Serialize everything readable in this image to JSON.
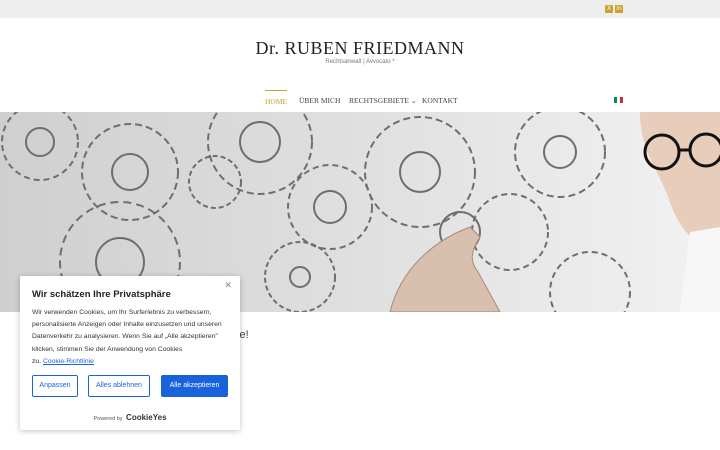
{
  "topbar": {
    "social": [
      "xing-icon",
      "linkedin-icon"
    ],
    "accent": "#c9a227"
  },
  "site": {
    "title": "Dr. RUBEN FRIEDMANN",
    "tagline": "Rechtsanwalt | Avvocato *"
  },
  "nav": {
    "items": [
      {
        "label": "HOME",
        "active": true
      },
      {
        "label": "ÜBER MICH"
      },
      {
        "label": "RECHTSGEBIETE"
      },
      {
        "label": "KONTAKT"
      }
    ],
    "language_flag": "italian-flag-icon"
  },
  "hero": {
    "image": "gears-and-hand-photo"
  },
  "main": {
    "intro_visible": "ite!"
  },
  "cookie": {
    "title": "Wir schätzen Ihre Privatsphäre",
    "text_lines": [
      "Wir verwenden Cookies, um Ihr Surferlebnis zu verbessern,",
      "personalisierte Anzeigen oder Inhalte einzusetzen und unseren",
      "Datenverkehr zu analysieren. Wenn Sie auf „Alle akzeptieren\"",
      "klicken, stimmen Sie der Anwendung von Cookies",
      "zu."
    ],
    "policy_link": "Cookie-Richtlinie",
    "buttons": {
      "customize": "Anpassen",
      "reject": "Alles ablehnen",
      "accept": "Alle akzeptieren"
    },
    "powered_by": "Powered by",
    "brand": "CookieYes",
    "accent": "#1863dc"
  }
}
